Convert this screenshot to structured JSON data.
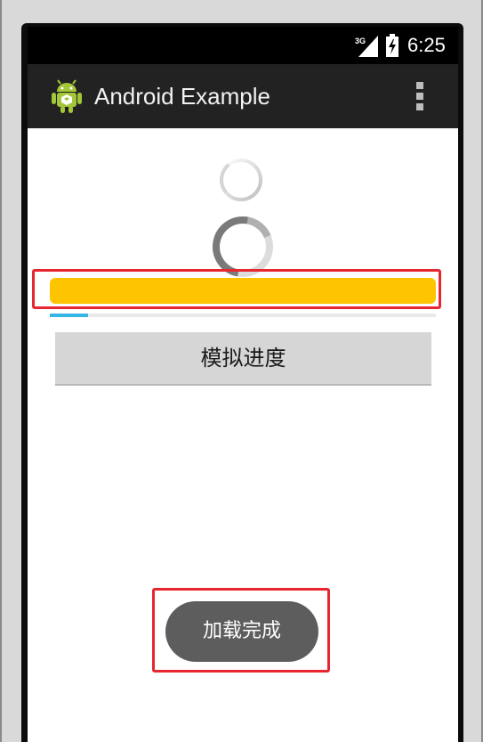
{
  "status_bar": {
    "network_label": "3G",
    "time": "6:25",
    "icons": [
      "signal-icon",
      "battery-icon"
    ]
  },
  "action_bar": {
    "title": "Android Example",
    "icons": [
      "android-app-icon",
      "overflow-menu-icon"
    ]
  },
  "progress": {
    "horizontal_progress_fraction": 1.0,
    "blue_progress_fraction": 0.1,
    "horizontal_color": "#ffc400",
    "blue_color": "#33b5e5"
  },
  "buttons": {
    "simulate_progress_label": "模拟进度"
  },
  "toast": {
    "message": "加载完成"
  },
  "colors": {
    "highlight": "#e8262f",
    "action_bar": "#222222",
    "android_green": "#a4c639"
  }
}
